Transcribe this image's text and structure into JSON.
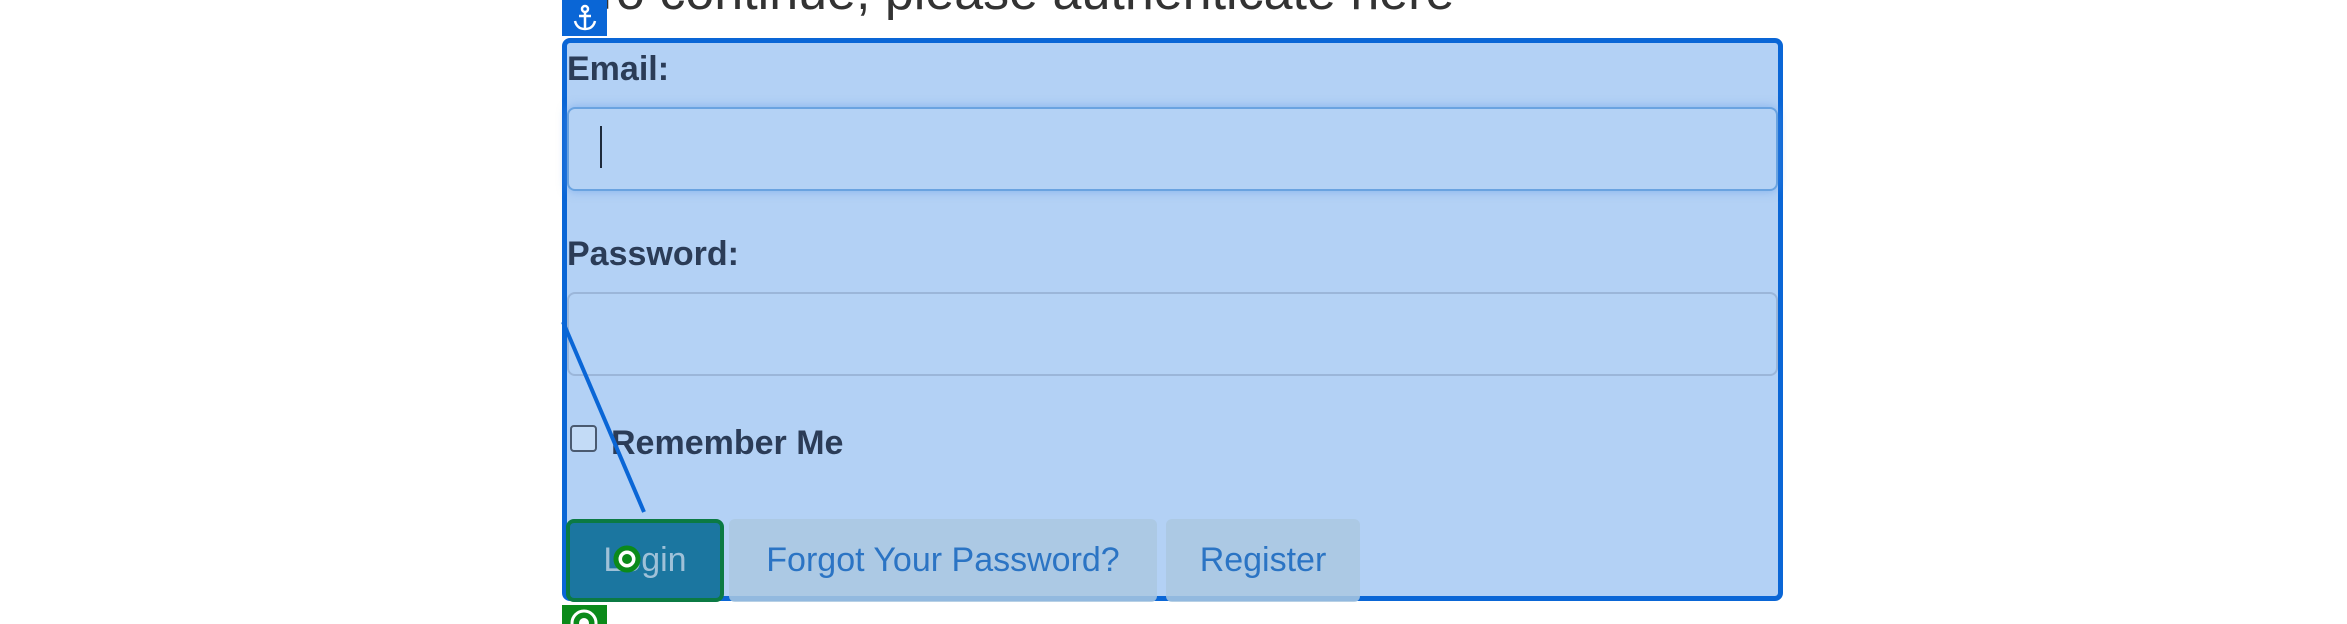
{
  "page": {
    "heading": "To continue, please authenticate here"
  },
  "form": {
    "email_label": "Email:",
    "email_value": "",
    "password_label": "Password:",
    "password_value": "",
    "remember_label": "Remember Me",
    "remember_checked": false
  },
  "buttons": {
    "login": "Login",
    "forgot": "Forgot Your Password?",
    "register": "Register"
  },
  "overlay": {
    "anchor_icon": "anchor-icon",
    "target_icon": "target-icon",
    "highlight_color": "#0a66d6",
    "target_color": "#0b8a1a"
  }
}
